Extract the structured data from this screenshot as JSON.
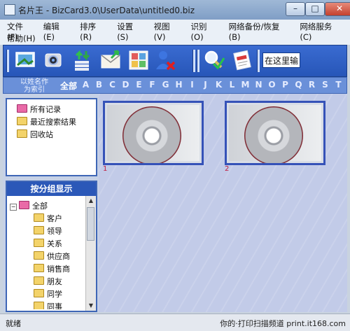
{
  "window": {
    "title": "名片王 - BizCard3.0\\UserData\\untitled0.biz",
    "minimize": "–",
    "maximize": "□",
    "close": "✕"
  },
  "menu": {
    "items": [
      "文件(F)",
      "编辑(E)",
      "排序(R)",
      "设置(S)",
      "视图(V)",
      "识别(O)",
      "网络备份/恢复(B)",
      "网络服务(C)",
      "帮助(H)"
    ]
  },
  "toolbar": {
    "buttons": [
      "scan-icon",
      "camera-icon",
      "import-export-icon",
      "mail-icon",
      "image-grid-icon",
      "delete-user-icon",
      "search-icon",
      "vcard-icon"
    ],
    "search_value": "在这里输"
  },
  "alphabet": {
    "sort_label_line1": "以姓名作",
    "sort_label_line2": "为索引",
    "all_label": "全部",
    "letters": [
      "A",
      "B",
      "C",
      "D",
      "E",
      "F",
      "G",
      "H",
      "I",
      "J",
      "K",
      "L",
      "M",
      "N",
      "O",
      "P",
      "Q",
      "R",
      "S",
      "T"
    ]
  },
  "left_top_tree": [
    {
      "label": "所有记录",
      "icon": "pink-folder-icon"
    },
    {
      "label": "最近搜索结果",
      "icon": "folder-icon"
    },
    {
      "label": "回收站",
      "icon": "folder-icon"
    }
  ],
  "groups": {
    "header": "按分组显示",
    "root": "全部",
    "items": [
      "客户",
      "领导",
      "关系",
      "供应商",
      "销售商",
      "朋友",
      "同学",
      "同事"
    ]
  },
  "cards": [
    {
      "number": "1"
    },
    {
      "number": "2"
    }
  ],
  "status": {
    "text": "就绪",
    "watermark": "你的·打印扫描频道  print.it168.com"
  }
}
